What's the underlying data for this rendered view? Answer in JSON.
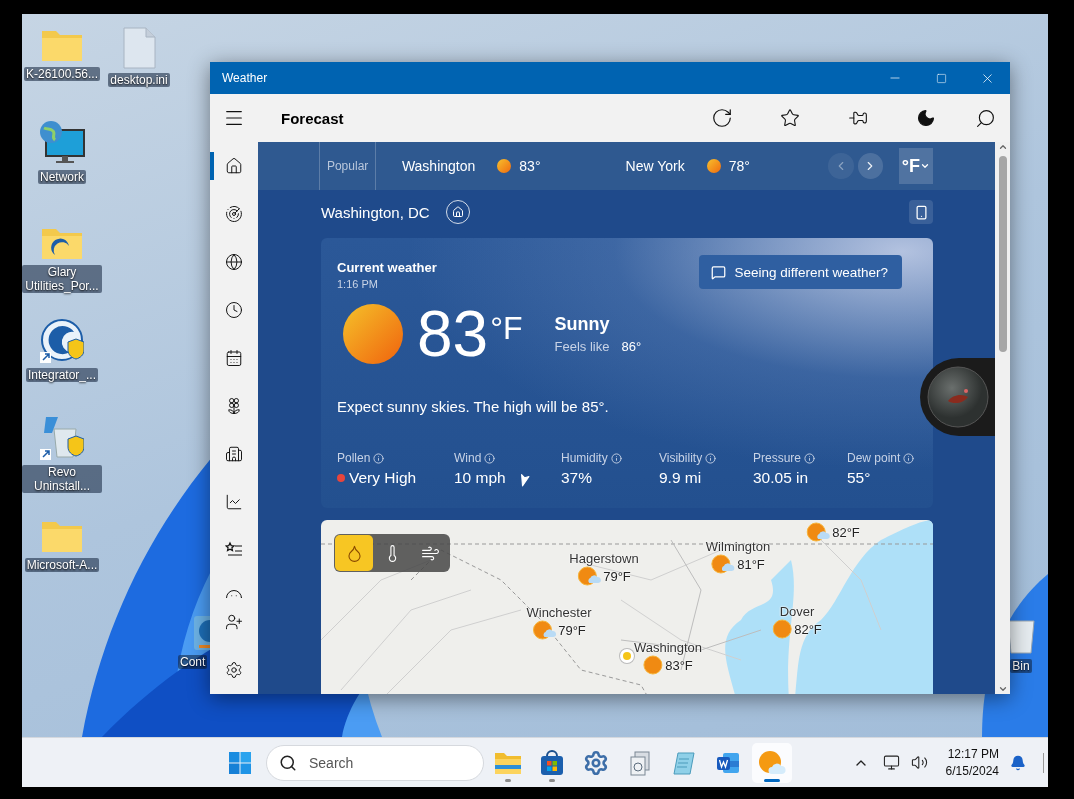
{
  "desktop_icons": [
    {
      "label": "K-26100.56...",
      "kind": "folder"
    },
    {
      "label": "desktop.ini",
      "kind": "file"
    },
    {
      "label": "Network",
      "kind": "network"
    },
    {
      "label": "Glary Utilities_Por...",
      "kind": "folder-app"
    },
    {
      "label": "Integrator_...",
      "kind": "shortcut-app"
    },
    {
      "label": "Revo Uninstall...",
      "kind": "shortcut-revo"
    },
    {
      "label": "Microsoft-A...",
      "kind": "folder"
    },
    {
      "label": "Cont",
      "kind": "control-panel"
    },
    {
      "label": "Bin",
      "kind": "bin"
    }
  ],
  "window": {
    "title": "Weather",
    "page_title": "Forecast"
  },
  "nav_items": [
    {
      "kind": "home",
      "selected": true
    },
    {
      "kind": "radar",
      "selected": false
    },
    {
      "kind": "globe",
      "selected": false
    },
    {
      "kind": "clock",
      "selected": false
    },
    {
      "kind": "calendar",
      "selected": false
    },
    {
      "kind": "flower",
      "selected": false
    },
    {
      "kind": "building",
      "selected": false
    },
    {
      "kind": "chart",
      "selected": false
    },
    {
      "kind": "star-list",
      "selected": false
    },
    {
      "kind": "smile",
      "selected": false
    }
  ],
  "nav_bottom": [
    {
      "kind": "person-add",
      "selected": false
    },
    {
      "kind": "settings",
      "selected": false
    }
  ],
  "popular_strip": {
    "label": "Popular",
    "cities": [
      {
        "name": "Washington",
        "temp": "83°"
      },
      {
        "name": "New York",
        "temp": "78°"
      }
    ],
    "unit": "°F"
  },
  "location": {
    "name": "Washington, DC"
  },
  "current": {
    "heading": "Current weather",
    "time": "1:16 PM",
    "feedback": "Seeing different weather?",
    "temp": "83",
    "unit": "°F",
    "condition": "Sunny",
    "feels_label": "Feels like",
    "feels_value": "86°",
    "summary": "Expect sunny skies. The high will be 85°.",
    "details": [
      {
        "label": "Pollen",
        "value": "Very High",
        "kind": "pollen"
      },
      {
        "label": "Wind",
        "value": "10 mph",
        "kind": "wind"
      },
      {
        "label": "Humidity",
        "value": "37%",
        "kind": "plain"
      },
      {
        "label": "Visibility",
        "value": "9.9 mi",
        "kind": "plain"
      },
      {
        "label": "Pressure",
        "value": "30.05 in",
        "kind": "plain"
      },
      {
        "label": "Dew point",
        "value": "55°",
        "kind": "plain"
      }
    ]
  },
  "map": {
    "layers": [
      {
        "kind": "precipitation",
        "selected": true
      },
      {
        "kind": "temperature",
        "selected": false
      },
      {
        "kind": "wind",
        "selected": false
      }
    ],
    "cities": [
      {
        "temp": "82°F",
        "kind": "partly-cloudy"
      },
      {
        "name": "Hagerstown",
        "temp": "79°F",
        "kind": "partly-cloudy"
      },
      {
        "name": "Wilmington",
        "temp": "81°F",
        "kind": "partly-cloudy"
      },
      {
        "name": "Winchester",
        "temp": "79°F",
        "kind": "partly-cloudy"
      },
      {
        "name": "Dover",
        "temp": "82°F",
        "kind": "sunny"
      },
      {
        "name": "Washington",
        "temp": "83°F",
        "kind": "sunny"
      }
    ]
  },
  "taskbar": {
    "search_placeholder": "Search",
    "apps": [
      {
        "kind": "explorer",
        "running": true,
        "selected": false
      },
      {
        "kind": "store",
        "running": true,
        "selected": false
      },
      {
        "kind": "settings",
        "running": false,
        "selected": false
      },
      {
        "kind": "app",
        "running": false,
        "selected": false
      },
      {
        "kind": "notepad",
        "running": false,
        "selected": false
      },
      {
        "kind": "document",
        "running": false,
        "selected": false
      },
      {
        "kind": "weather",
        "running": true,
        "selected": true
      }
    ],
    "time": "12:17 PM",
    "date": "6/15/2024"
  }
}
